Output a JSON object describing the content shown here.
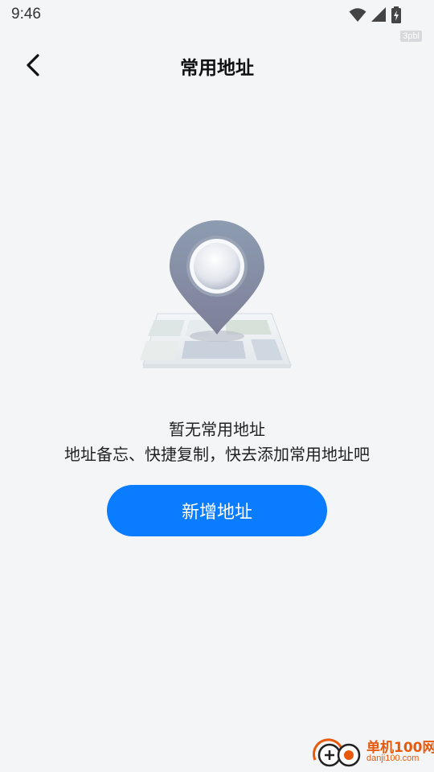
{
  "status_bar": {
    "time": "9:46",
    "tag": "3pbl",
    "icons": [
      "wifi-icon",
      "cellular-signal-icon",
      "battery-charging-icon"
    ]
  },
  "header": {
    "back_icon": "chevron-left-icon",
    "title": "常用地址"
  },
  "empty_state": {
    "illustration": "map-pin-illustration",
    "title": "暂无常用地址",
    "description": "地址备忘、快捷复制，快去添加常用地址吧",
    "button_label": "新增地址"
  },
  "watermark": {
    "name": "单机100网",
    "url": "danji100.com"
  },
  "colors": {
    "background": "#f4f5f7",
    "accent": "#0a7cff",
    "watermark": "#e8590c"
  }
}
